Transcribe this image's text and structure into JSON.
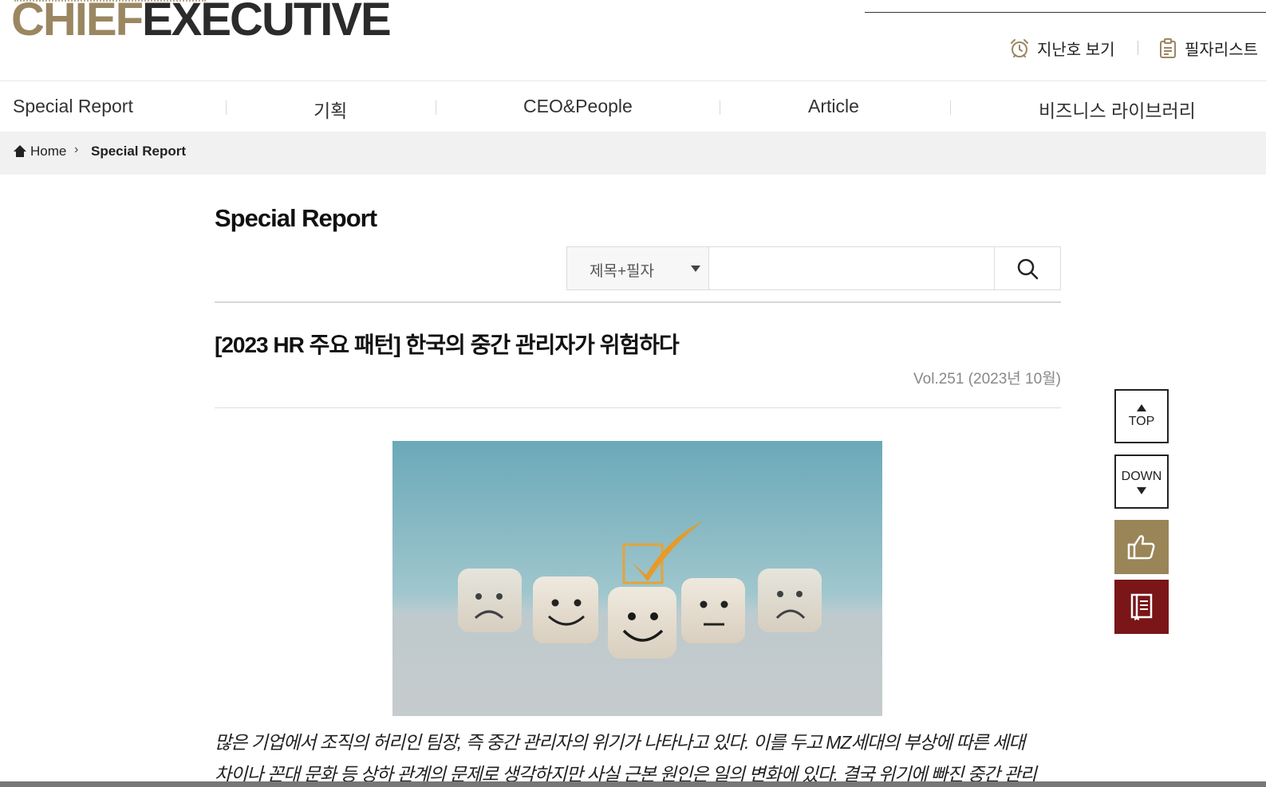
{
  "header": {
    "logo_part1": "CHIEF",
    "logo_part2": "EXECUTIVE",
    "back_issues_label": "지난호 보기",
    "back_issues_icon": "alarm-clock-icon",
    "authors_label": "필자리스트",
    "authors_icon": "clipboard-icon"
  },
  "nav": {
    "items": [
      {
        "label": "Special Report"
      },
      {
        "label": "기획"
      },
      {
        "label": "CEO&People"
      },
      {
        "label": "Article"
      },
      {
        "label": "비즈니스 라이브러리"
      }
    ]
  },
  "breadcrumb": {
    "home_label": "Home",
    "home_icon": "home-icon",
    "separator": "›",
    "current": "Special Report"
  },
  "main": {
    "page_title": "Special Report",
    "search": {
      "select_value": "제목+필자",
      "input_value": "",
      "input_placeholder": "",
      "button_icon": "search-icon"
    },
    "article": {
      "title": "[2023 HR 주요 패턴] 한국의 중간 관리자가 위험하다",
      "volume": "Vol.251 (2023년 10월)",
      "lead_lines": [
        "많은 기업에서 조직의 허리인 팀장, 즉 중간 관리자의 위기가 나타나고 있다. 이를 두고 MZ세대의 부상에 따른 세대",
        "차이나 꼰대 문화 등 상하 관계의 문제로 생각하지만 사실 근본 원인은 일의 변화에 있다. 결국 위기에 빠진 중간 관리"
      ]
    }
  },
  "side": {
    "top_label": "TOP",
    "down_label": "DOWN",
    "like_icon": "thumbs-up-icon",
    "book_icon": "notebook-icon"
  },
  "colors": {
    "brand_gold": "#9a8762",
    "like_bg": "#9a8558",
    "book_bg": "#7a1518"
  }
}
